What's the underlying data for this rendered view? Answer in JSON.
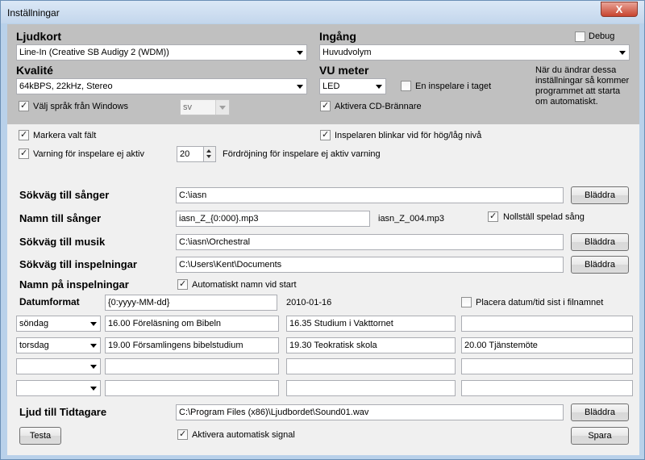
{
  "window": {
    "title": "Inställningar",
    "close_glyph": "X"
  },
  "soundcard": {
    "label": "Ljudkort",
    "value": "Line-In (Creative SB Audigy 2 (WDM))"
  },
  "input": {
    "label": "Ingång",
    "value": "Huvudvolym"
  },
  "debug": {
    "label": "Debug",
    "checked": false
  },
  "quality": {
    "label": "Kvalité",
    "value": "64kBPS, 22kHz, Stereo"
  },
  "vu": {
    "label": "VU meter",
    "value": "LED"
  },
  "one_recorder": {
    "label": "En inspelare i taget",
    "checked": false
  },
  "restart_note": "När du ändrar dessa inställningar så kommer programmet att starta om automatiskt.",
  "language": {
    "label": "Välj språk från Windows",
    "checked": true,
    "value": "sv"
  },
  "cd_burner": {
    "label": "Aktivera CD-Brännare",
    "checked": true
  },
  "mark_field": {
    "label": "Markera valt fält",
    "checked": true
  },
  "recorder_blinks": {
    "label": "Inspelaren blinkar vid för hög/låg nivå",
    "checked": true
  },
  "inactive_warning": {
    "label": "Varning för inspelare ej aktiv",
    "checked": true,
    "delay_value": "20",
    "delay_label": "Fördröjning för inspelare ej aktiv varning"
  },
  "song_path": {
    "label": "Sökväg till sånger",
    "value": "C:\\iasn",
    "browse": "Bläddra"
  },
  "song_name": {
    "label": "Namn till sånger",
    "value": "iasn_Z_{0:000}.mp3",
    "preview": "iasn_Z_004.mp3",
    "reset_label": "Nollställ spelad sång",
    "reset_checked": true
  },
  "music_path": {
    "label": "Sökväg till musik",
    "value": "C:\\iasn\\Orchestral",
    "browse": "Bläddra"
  },
  "recordings_path": {
    "label": "Sökväg till inspelningar",
    "value": "C:\\Users\\Kent\\Documents",
    "browse": "Bläddra"
  },
  "recording_name": {
    "label": "Namn på inspelningar",
    "auto_label": "Automatiskt namn vid start",
    "auto_checked": true
  },
  "date_format": {
    "label": "Datumformat",
    "value": "{0:yyyy-MM-dd}",
    "preview": "2010-01-16",
    "place_last_label": "Placera datum/tid sist i filnamnet",
    "place_last_checked": false
  },
  "schedule": [
    {
      "day": "söndag",
      "slot1": "16.00 Föreläsning om Bibeln",
      "slot2": "16.35 Studium i Vakttornet",
      "slot3": ""
    },
    {
      "day": "torsdag",
      "slot1": "19.00 Församlingens bibelstudium",
      "slot2": "19.30 Teokratisk skola",
      "slot3": "20.00 Tjänstemöte"
    },
    {
      "day": "",
      "slot1": "",
      "slot2": "",
      "slot3": ""
    },
    {
      "day": "",
      "slot1": "",
      "slot2": "",
      "slot3": ""
    }
  ],
  "timer_sound": {
    "label": "Ljud till Tidtagare",
    "value": "C:\\Program Files (x86)\\Ljudbordet\\Sound01.wav",
    "browse": "Bläddra"
  },
  "auto_signal": {
    "label": "Aktivera automatisk signal",
    "checked": true
  },
  "buttons": {
    "test": "Testa",
    "save": "Spara"
  }
}
